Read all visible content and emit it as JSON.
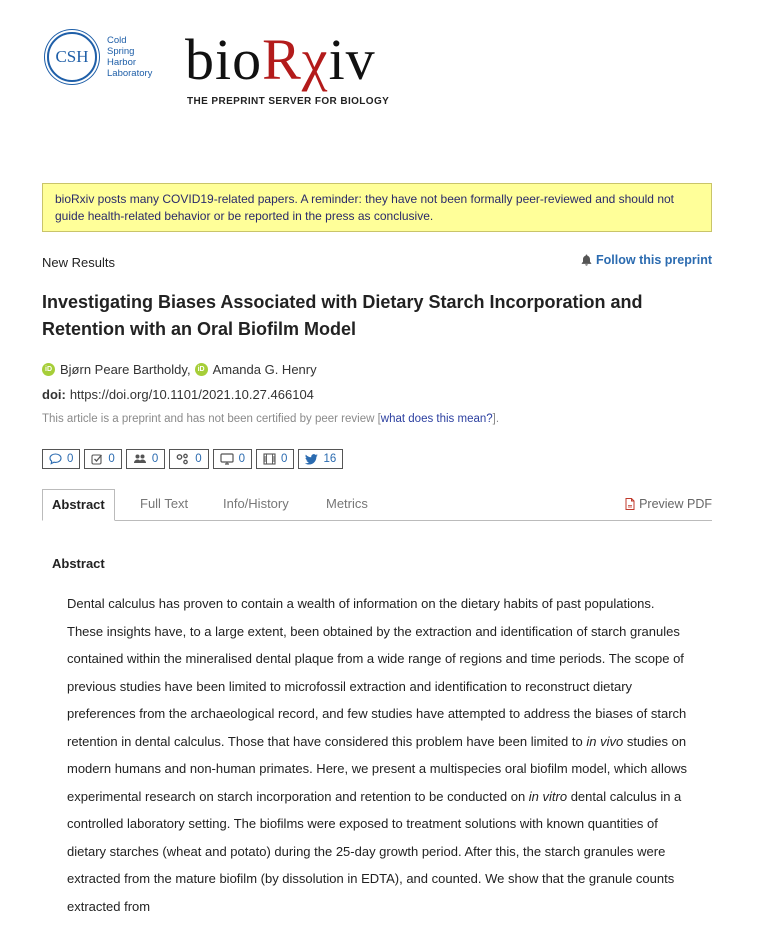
{
  "header": {
    "csh_logo": {
      "initials": "CSH",
      "lines": [
        "Cold",
        "Spring",
        "Harbor",
        "Laboratory"
      ]
    },
    "biorxiv_logo": {
      "part1": "bio",
      "part2": "Rχ",
      "part3": "iv",
      "tagline": "THE PREPRINT SERVER FOR BIOLOGY"
    }
  },
  "notice": "bioRxiv posts many COVID19-related papers. A reminder: they have not been formally peer-reviewed and should not guide health-related behavior or be reported in the press as conclusive.",
  "article_type": "New Results",
  "follow_label": "Follow this preprint",
  "title": "Investigating Biases Associated with Dietary Starch Incorporation and Retention with an Oral Biofilm Model",
  "authors": [
    {
      "name": "Bjørn Peare Bartholdy",
      "suffix": ","
    },
    {
      "name": "Amanda G. Henry",
      "suffix": ""
    }
  ],
  "doi": {
    "label": "doi:",
    "value": "https://doi.org/10.1101/2021.10.27.466104"
  },
  "preprint_note": {
    "before": "This article is a preprint and has not been certified by peer review [",
    "link": "what does this mean?",
    "after": "]."
  },
  "metrics": [
    {
      "icon": "comment-icon",
      "count": "0"
    },
    {
      "icon": "check-square-icon",
      "count": "0"
    },
    {
      "icon": "users-icon",
      "count": "0"
    },
    {
      "icon": "share-nodes-icon",
      "count": "0"
    },
    {
      "icon": "monitor-icon",
      "count": "0"
    },
    {
      "icon": "film-icon",
      "count": "0"
    },
    {
      "icon": "twitter-icon",
      "count": "16"
    }
  ],
  "tabs": [
    "Abstract",
    "Full Text",
    "Info/History",
    "Metrics"
  ],
  "active_tab": "Abstract",
  "preview_pdf": "Preview PDF",
  "abstract_heading": "Abstract",
  "abstract": {
    "p1": "Dental calculus has proven to contain a wealth of information on the dietary habits of past populations. These insights have, to a large extent, been obtained by the extraction and identification of starch granules contained within the mineralised dental plaque from a wide range of regions and time periods. The scope of previous studies have been limited to microfossil extraction and identification to reconstruct dietary preferences from the archaeological record, and few studies have attempted to address the biases of starch retention in dental calculus. Those that have considered this problem have been limited to ",
    "italic1": "in vivo",
    "p2": " studies on modern humans and non-human primates. Here, we present a multispecies oral biofilm model, which allows experimental research on starch incorporation and retention to be conducted on ",
    "italic2": "in vitro",
    "p3": " dental calculus in a controlled laboratory setting. The biofilms were exposed to treatment solutions with known quantities of dietary starches (wheat and potato) during the 25-day growth period. After this, the starch granules were extracted from the mature biofilm (by dissolution in EDTA), and counted. We show that the granule counts extracted from"
  },
  "colors": {
    "link": "#2b6bb0",
    "notice_bg": "#ffff99",
    "brand_red": "#b31b1b",
    "orcid": "#a6ce39"
  }
}
